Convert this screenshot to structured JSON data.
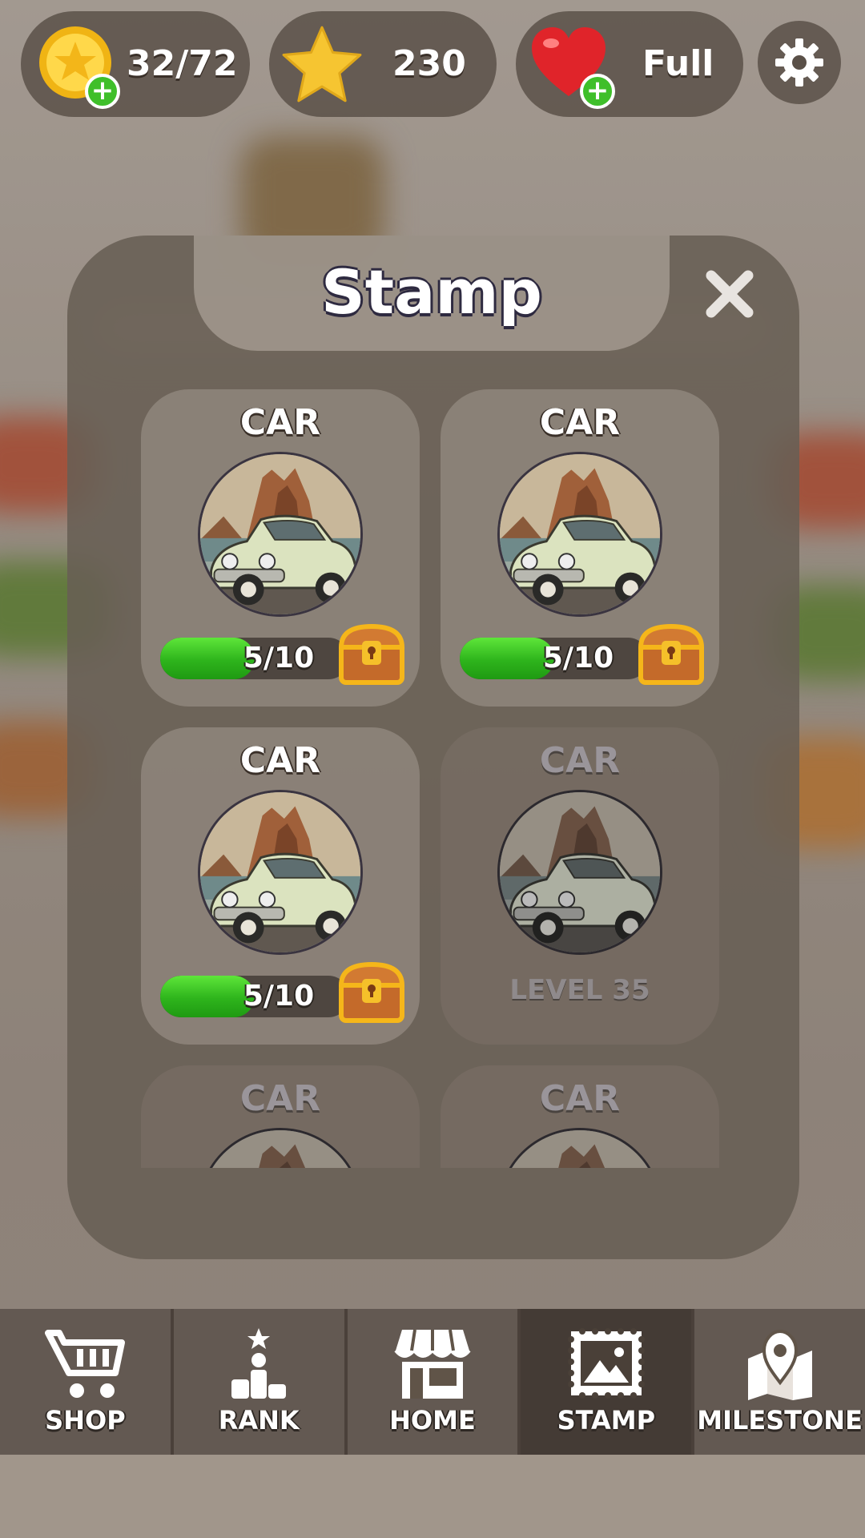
{
  "topbar": {
    "coins": "32/72",
    "stars": "230",
    "lives": "Full"
  },
  "panel": {
    "title": "Stamp"
  },
  "stamps": [
    {
      "title": "CAR",
      "progress_text": "5/10",
      "progress": 0.5,
      "locked": false
    },
    {
      "title": "CAR",
      "progress_text": "5/10",
      "progress": 0.5,
      "locked": false
    },
    {
      "title": "CAR",
      "progress_text": "5/10",
      "progress": 0.5,
      "locked": false
    },
    {
      "title": "CAR",
      "level_text": "LEVEL 35",
      "locked": true
    },
    {
      "title": "CAR",
      "locked": true
    },
    {
      "title": "CAR",
      "locked": true
    }
  ],
  "nav": {
    "items": [
      {
        "label": "SHOP",
        "icon": "cart-icon"
      },
      {
        "label": "RANK",
        "icon": "podium-icon"
      },
      {
        "label": "HOME",
        "icon": "store-icon"
      },
      {
        "label": "STAMP",
        "icon": "stamp-icon",
        "active": true
      },
      {
        "label": "MILESTONE",
        "icon": "map-pin-icon"
      }
    ]
  },
  "colors": {
    "progress_green": "#2eb41c",
    "plus_green": "#3fbf2a",
    "panel": "#685e54"
  }
}
